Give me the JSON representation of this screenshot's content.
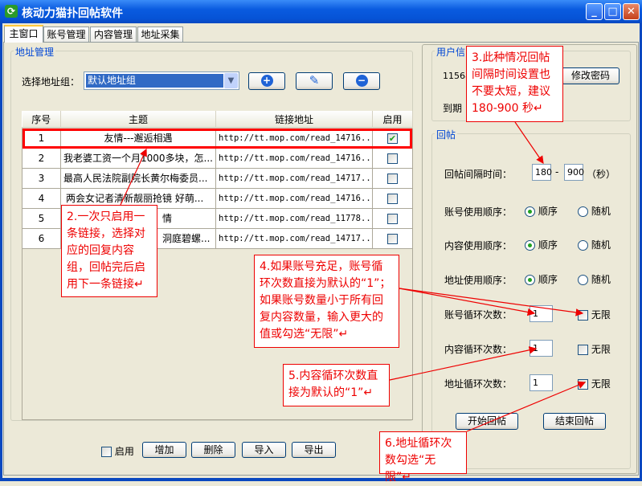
{
  "window": {
    "title": "核动力猫扑回帖软件",
    "icon": "app-refresh-icon",
    "controls": {
      "minimize": "_",
      "maximize": "□",
      "close": "✕"
    }
  },
  "tabs": [
    {
      "label": "主窗口",
      "active": true
    },
    {
      "label": "账号管理"
    },
    {
      "label": "内容管理"
    },
    {
      "label": "地址采集"
    }
  ],
  "address": {
    "group_title": "地址管理",
    "select_label": "选择地址组：",
    "selected_group": "默认地址组",
    "icons": {
      "add": "plus-circle-icon",
      "edit": "pencil-icon",
      "remove": "minus-circle-icon"
    },
    "columns": [
      "序号",
      "主题",
      "链接地址",
      "启用"
    ],
    "rows": [
      {
        "no": "1",
        "subject": "友情---邂逅相遇",
        "url": "http://tt.mop.com/read_14716...",
        "enabled": true
      },
      {
        "no": "2",
        "subject": "我老婆工资一个月1000多块，怎...",
        "url": "http://tt.mop.com/read_14716...",
        "enabled": false
      },
      {
        "no": "3",
        "subject": "最高人民法院副院长黄尔梅委员...",
        "url": "http://tt.mop.com/read_14717...",
        "enabled": false
      },
      {
        "no": "4",
        "subject": "两会女记者清新靓丽抢镜 好萌...",
        "url": "http://tt.mop.com/read_14716...",
        "enabled": false
      },
      {
        "no": "5",
        "subject": "情",
        "url": "http://tt.mop.com/read_11778...",
        "enabled": false
      },
      {
        "no": "6",
        "subject": "洞庭碧螺...",
        "url": "http://tt.mop.com/read_14717...",
        "enabled": false
      }
    ],
    "enable_label": "启用",
    "buttons": {
      "add": "增加",
      "delete": "删除",
      "import": "导入",
      "export": "导出"
    }
  },
  "user": {
    "group_title": "用户信",
    "id": "11568",
    "expire_label": "到期",
    "change_password": "修改密码"
  },
  "reply": {
    "group_title": "回帖",
    "interval_label": "回帖间隔时间：",
    "interval_min": "180",
    "dash": "-",
    "interval_max": "900",
    "unit": "（秒）",
    "order_rows": [
      {
        "label": "账号使用顺序：",
        "selected": "顺序"
      },
      {
        "label": "内容使用顺序：",
        "selected": "顺序"
      },
      {
        "label": "地址使用顺序：",
        "selected": "顺序"
      }
    ],
    "opt_seq": "顺序",
    "opt_rand": "随机",
    "loop_rows": [
      {
        "label": "账号循环次数：",
        "value": "1",
        "unlimited": false
      },
      {
        "label": "内容循环次数：",
        "value": "1",
        "unlimited": false
      },
      {
        "label": "地址循环次数：",
        "value": "1",
        "unlimited": true
      }
    ],
    "unlimited_label": "无限",
    "start": "开始回帖",
    "stop": "结束回帖"
  },
  "callouts": {
    "c2": "2.一次只启用一条链接，选择对应的回复内容组，回帖完后启用下一条链接↵",
    "c3": "3.此种情况回帖间隔时间设置也不要太短，建议180-900 秒↵",
    "c4": "4.如果账号充足，账号循环次数直接为默认的“1”；如果账号数量小于所有回复内容数量，输入更大的值或勾选“无限”↵",
    "c5": "5.内容循环次数直接为默认的“1”↵",
    "c6": "6.地址循环次数勾选“无限”↵"
  },
  "colors": {
    "accent": "#E00000",
    "title_blue": "#0A5BE0",
    "group_label": "#0046D5"
  }
}
